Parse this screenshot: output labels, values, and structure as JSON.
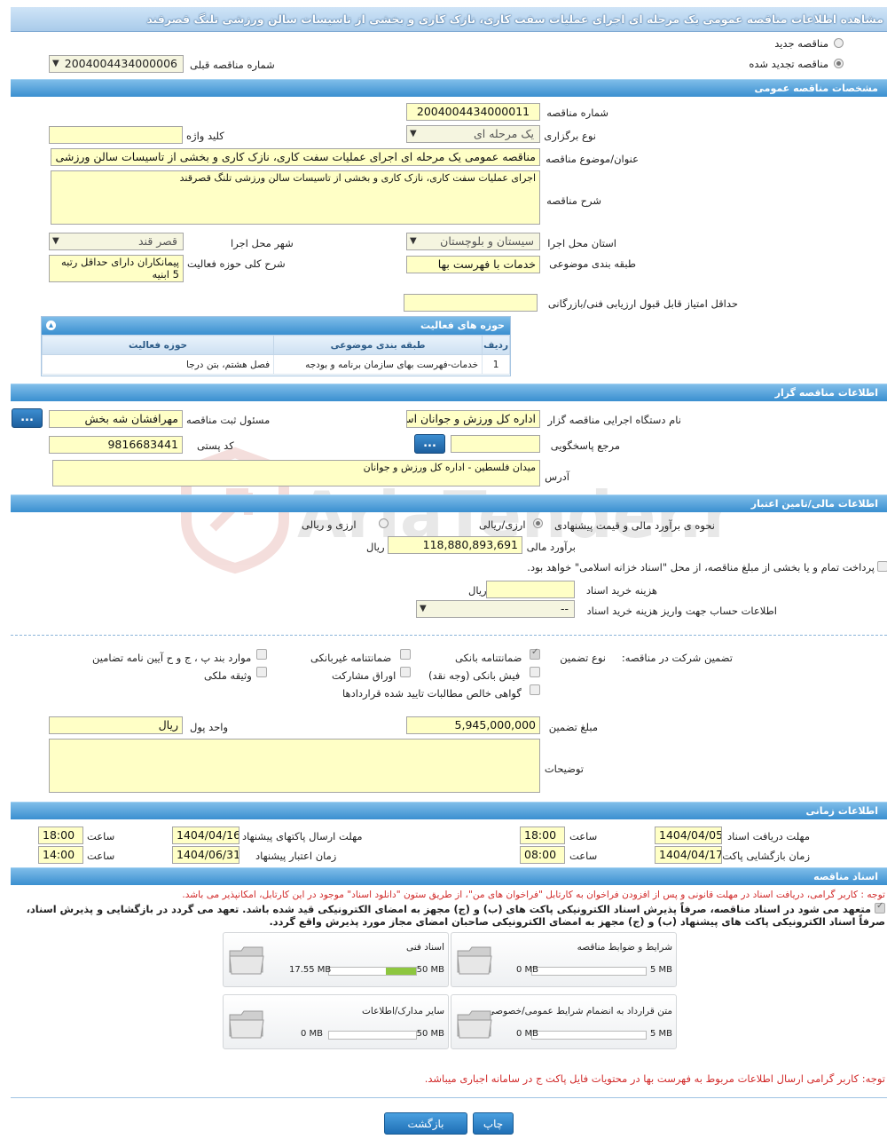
{
  "page_title": "مشاهده اطلاعات مناقصه عمومی یک مرحله ای اجرای عملیات سفت کاری، نازک کاری و بخشی از تاسیسات سالن ورزشی تلنگ قصرقند",
  "tender_type": {
    "new_label": "مناقصه جدید",
    "renewed_label": "مناقصه تجدید شده",
    "prev_number_label": "شماره مناقصه قبلی",
    "prev_number_value": "2004004434000006"
  },
  "general": {
    "section_title": "مشخصات مناقصه عمومی",
    "number_label": "شماره مناقصه",
    "number_value": "2004004434000011",
    "hold_type_label": "نوع برگزاری",
    "hold_type_value": "یک مرحله ای",
    "keyword_label": "کلید واژه",
    "keyword_value": "",
    "subject_label": "عنوان/موضوع مناقصه",
    "subject_value": "مناقصه عمومی یک مرحله ای اجرای عملیات سفت کاری، نازک کاری و بخشی از تاسیسات سالن ورزشی تلنگ قصرقند",
    "description_label": "شرح مناقصه",
    "description_value": "اجرای عملیات سفت کاری، نازک کاری و بخشی از تاسیسات سالن ورزشی تلنگ قصرقند",
    "province_label": "استان محل اجرا",
    "province_value": "سیستان و بلوچستان",
    "city_label": "شهر محل اجرا",
    "city_value": "قصر قند",
    "category_label": "طبقه بندی موضوعی",
    "category_value": "خدمات با فهرست بها",
    "activity_desc_label": "شرح کلی حوزه فعالیت",
    "activity_desc_value": "پیمانکاران دارای حداقل رتبه 5 ابنیه",
    "min_score_label": "حداقل امتیاز قابل قبول ارزیابی فنی/بازرگانی",
    "min_score_value": ""
  },
  "activity_table": {
    "title": "حوزه های فعالیت",
    "columns": [
      "ردیف",
      "طبقه بندی موضوعی",
      "حوزه فعالیت"
    ],
    "rows": [
      [
        "1",
        "خدمات-فهرست بهای سازمان برنامه و بودجه",
        "فصل هشتم، بتن درجا"
      ]
    ]
  },
  "organizer": {
    "section_title": "اطلاعات مناقصه گزار",
    "org_label": "نام دستگاه اجرایی مناقصه گزار",
    "org_value": "اداره کل ورزش و جوانان استان سیستان و بلوچستان",
    "registrar_label": "مسئول ثبت مناقصه",
    "registrar_value": "مهرافشان شه بخش",
    "dots_button": "...",
    "reference_label": "مرجع پاسخگویی",
    "reference_value": "",
    "postal_label": "کد پستی",
    "postal_value": "9816683441",
    "address_label": "آدرس",
    "address_value": "میدان فلسطین - اداره کل ورزش و جوانان"
  },
  "financial": {
    "section_title": "اطلاعات مالی/تامین اعتبار",
    "estimate_method_label": "نحوه ی برآورد مالی و قیمت پیشنهادی",
    "opt_currency": "ارزی/ریالی",
    "opt_rial": "ارزی و ریالی",
    "estimate_label": "برآورد مالی",
    "estimate_value": "118,880,893,691",
    "estimate_unit": "ریال",
    "treasury_text": "پرداخت تمام و یا بخشی از مبلغ مناقصه، از محل \"اسناد خزانه اسلامی\" خواهد بود.",
    "doc_cost_label": "هزینه خرید اسناد",
    "doc_cost_value": "",
    "doc_cost_unit": "ریال",
    "account_label": "اطلاعات حساب جهت واریز هزینه خرید اسناد",
    "account_value": "--"
  },
  "guarantee": {
    "label": "تضمین شرکت در مناقصه:",
    "type_label": "نوع تضمین",
    "opt_bank": "ضمانتنامه بانکی",
    "opt_nonbank": "ضمانتنامه غیربانکی",
    "opt_items": "موارد بند پ ، ج و ح آیین نامه تضامین",
    "opt_cash": "فیش بانکی (وجه نقد)",
    "opt_bonds": "اوراق مشارکت",
    "opt_property": "وثیقه ملکی",
    "opt_receivables": "گواهی خالص مطالبات تایید شده قراردادها",
    "amount_label": "مبلغ تضمین",
    "amount_value": "5,945,000,000",
    "currency_label": "واحد پول",
    "currency_value": "ریال",
    "notes_label": "توضیحات",
    "notes_value": ""
  },
  "timing": {
    "section_title": "اطلاعات زمانی",
    "receive_label": "مهلت دریافت اسناد",
    "receive_date": "1404/04/05",
    "receive_time": "18:00",
    "send_label": "مهلت ارسال پاکتهای پیشنهاد",
    "send_date": "1404/04/16",
    "send_time": "18:00",
    "open_label": "زمان بازگشایی پاکت ها",
    "open_date": "1404/04/17",
    "open_time": "08:00",
    "validity_label": "زمان اعتبار پیشنهاد",
    "validity_date": "1404/06/31",
    "validity_time": "14:00",
    "time_label": "ساعت"
  },
  "documents": {
    "section_title": "اسناد مناقصه",
    "notice1": "توجه : کاربر گرامی، دریافت اسناد در مهلت قانونی و پس از افزودن فراخوان به کارتابل \"فراخوان های من\"، از طریق ستون \"دانلود اسناد\" موجود در این کارتابل، امکانپذیر می باشد.",
    "commit_line1": "متعهد می شود در اسناد مناقصه، صرفاً پذیرش اسناد الکترونیکی پاکت های (ب) و (ج) مجهز به امضای الکترونیکی قید شده باشد. تعهد می گردد در بازگشایی و پذیرش اسناد،",
    "commit_line2": "صرفاً اسناد الکترونیکی پاکت های پیشنهاد (ب) و (ج) مجهز به امضای الکترونیکی صاحبان امضای مجاز مورد پذیرش واقع گردد.",
    "cards": [
      {
        "title": "شرایط و ضوابط مناقصه",
        "used": "0 MB",
        "max": "5 MB",
        "fraction": 0
      },
      {
        "title": "اسناد فنی",
        "used": "17.55 MB",
        "max": "50 MB",
        "fraction": 0.351
      },
      {
        "title": "متن قرارداد به انضمام شرایط عمومی/خصوصی",
        "used": "0 MB",
        "max": "5 MB",
        "fraction": 0
      },
      {
        "title": "سایر مدارک/اطلاعات",
        "used": "0 MB",
        "max": "50 MB",
        "fraction": 0
      }
    ],
    "notice2": "توجه: کاربر گرامی ارسال اطلاعات مربوط به فهرست بها در محتویات فایل پاکت ج در سامانه اجباری میباشد."
  },
  "buttons": {
    "print": "چاپ",
    "back": "بازگشت"
  },
  "watermark": "AriaTender.neT",
  "colors": {
    "section_bar": "#3a8fd0",
    "field_bg": "#ffffc6",
    "notice_red": "#d12a2a",
    "progress_green": "#8dc63f"
  }
}
